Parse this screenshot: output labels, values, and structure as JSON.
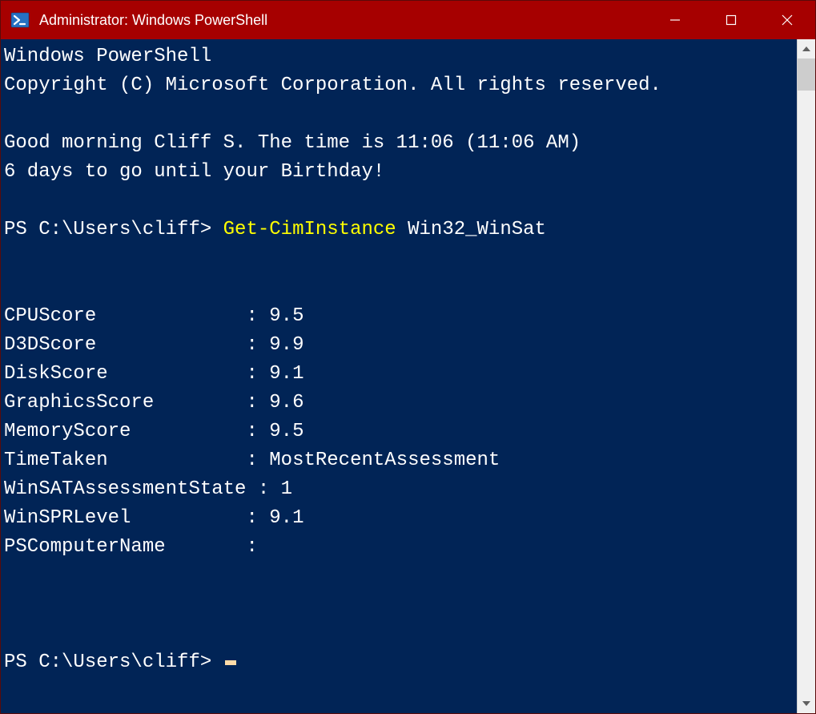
{
  "titlebar": {
    "title": "Administrator: Windows PowerShell"
  },
  "console": {
    "header_line1": "Windows PowerShell",
    "header_line2": "Copyright (C) Microsoft Corporation. All rights reserved.",
    "greeting_line1": "Good morning Cliff S. The time is 11:06 (11:06 AM)",
    "greeting_line2": "6 days to go until your Birthday!",
    "prompt1_prefix": "PS C:\\Users\\cliff> ",
    "prompt1_cmdlet": "Get-CimInstance",
    "prompt1_args": " Win32_WinSat",
    "output": [
      {
        "key": "CPUScore",
        "value": "9.5"
      },
      {
        "key": "D3DScore",
        "value": "9.9"
      },
      {
        "key": "DiskScore",
        "value": "9.1"
      },
      {
        "key": "GraphicsScore",
        "value": "9.6"
      },
      {
        "key": "MemoryScore",
        "value": "9.5"
      },
      {
        "key": "TimeTaken",
        "value": "MostRecentAssessment"
      },
      {
        "key": "WinSATAssessmentState",
        "value": "1"
      },
      {
        "key": "WinSPRLevel",
        "value": "9.1"
      },
      {
        "key": "PSComputerName",
        "value": ""
      }
    ],
    "output_keywidth": 21,
    "prompt2": "PS C:\\Users\\cliff> "
  }
}
